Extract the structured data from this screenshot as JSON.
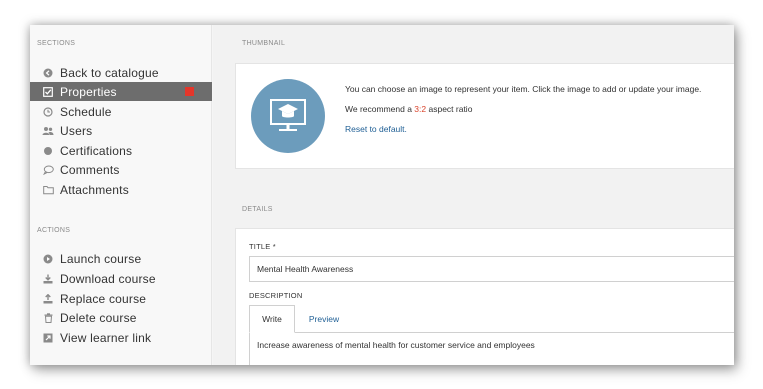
{
  "sidebar": {
    "sections_heading": "SECTIONS",
    "sections": [
      {
        "label": "Back to catalogue",
        "icon": "arrow-left-circle-icon"
      },
      {
        "label": "Properties",
        "icon": "checkbox-icon",
        "active": true
      },
      {
        "label": "Schedule",
        "icon": "clock-icon"
      },
      {
        "label": "Users",
        "icon": "users-icon"
      },
      {
        "label": "Certifications",
        "icon": "certificate-icon"
      },
      {
        "label": "Comments",
        "icon": "comment-icon"
      },
      {
        "label": "Attachments",
        "icon": "folder-icon"
      }
    ],
    "actions_heading": "ACTIONS",
    "actions": [
      {
        "label": "Launch course",
        "icon": "play-circle-icon"
      },
      {
        "label": "Download course",
        "icon": "download-icon"
      },
      {
        "label": "Replace course",
        "icon": "upload-icon"
      },
      {
        "label": "Delete course",
        "icon": "trash-icon"
      },
      {
        "label": "View learner link",
        "icon": "external-link-icon"
      }
    ],
    "flag_color": "#e4362a",
    "active_color": "#6d6d6d"
  },
  "thumbnail": {
    "heading": "THUMBNAIL",
    "line1": "You can choose an image to represent your item. Click the image to add or update your image.",
    "line2_prefix": "We recommend a ",
    "line2_ratio": "3:2",
    "line2_suffix": " aspect ratio",
    "reset_label": "Reset to default.",
    "circle_color": "#6c9cbc",
    "icon": "course-monitor-icon"
  },
  "details": {
    "heading": "DETAILS",
    "title_label": "TITLE *",
    "title_value": "Mental Health Awareness",
    "description_label": "DESCRIPTION",
    "tab_write": "Write",
    "tab_preview": "Preview",
    "description_value": "Increase awareness of mental health for customer service and employees"
  }
}
